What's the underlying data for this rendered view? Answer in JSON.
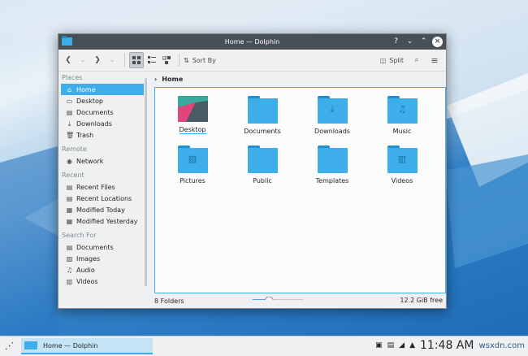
{
  "window": {
    "title": "Home — Dolphin",
    "titlebar_buttons": [
      "help-icon",
      "minimize-icon",
      "maximize-icon",
      "close-icon"
    ]
  },
  "toolbar": {
    "sort_label": "Sort By",
    "split_label": "Split"
  },
  "sidebar": {
    "sections": [
      {
        "title": "Places",
        "items": [
          {
            "label": "Home",
            "icon": "home-icon",
            "selected": true
          },
          {
            "label": "Desktop",
            "icon": "desktop-icon"
          },
          {
            "label": "Documents",
            "icon": "documents-icon"
          },
          {
            "label": "Downloads",
            "icon": "downloads-icon"
          },
          {
            "label": "Trash",
            "icon": "trash-icon"
          }
        ]
      },
      {
        "title": "Remote",
        "items": [
          {
            "label": "Network",
            "icon": "network-icon"
          }
        ]
      },
      {
        "title": "Recent",
        "items": [
          {
            "label": "Recent Files",
            "icon": "recent-files-icon"
          },
          {
            "label": "Recent Locations",
            "icon": "recent-locations-icon"
          },
          {
            "label": "Modified Today",
            "icon": "calendar-icon"
          },
          {
            "label": "Modified Yesterday",
            "icon": "calendar-icon"
          }
        ]
      },
      {
        "title": "Search For",
        "items": [
          {
            "label": "Documents",
            "icon": "documents-icon"
          },
          {
            "label": "Images",
            "icon": "images-icon"
          },
          {
            "label": "Audio",
            "icon": "audio-icon"
          },
          {
            "label": "Videos",
            "icon": "videos-icon"
          }
        ]
      }
    ]
  },
  "breadcrumb": {
    "current": "Home"
  },
  "files": [
    {
      "label": "Desktop",
      "icon": "desktop-folder-icon"
    },
    {
      "label": "Documents",
      "icon": "documents-folder-icon"
    },
    {
      "label": "Downloads",
      "icon": "downloads-folder-icon"
    },
    {
      "label": "Music",
      "icon": "music-folder-icon"
    },
    {
      "label": "Pictures",
      "icon": "pictures-folder-icon"
    },
    {
      "label": "Public",
      "icon": "public-folder-icon"
    },
    {
      "label": "Templates",
      "icon": "templates-folder-icon"
    },
    {
      "label": "Videos",
      "icon": "videos-folder-icon"
    }
  ],
  "status": {
    "count": "8 Folders",
    "free_space": "12.2 GiB free",
    "zoom_level": 0.27,
    "space_used_fraction": 0.3
  },
  "taskbar": {
    "task_label": "Home — Dolphin",
    "clock": "11:48 AM"
  },
  "watermark": "wsxdn.com",
  "colors": {
    "accent": "#3daee9",
    "titlebar": "#475057",
    "folder": "#3daee9"
  }
}
